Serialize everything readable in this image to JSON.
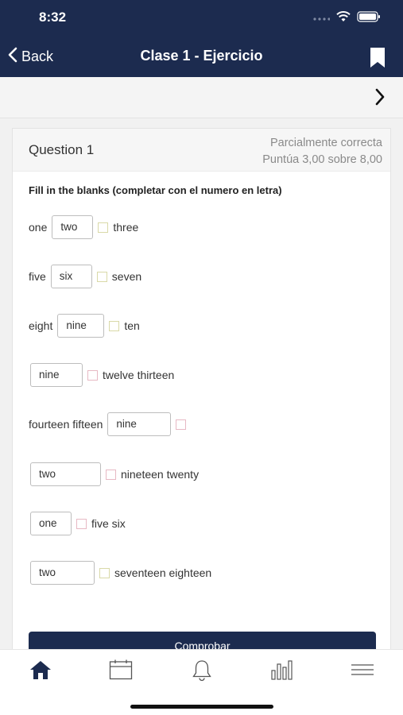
{
  "status": {
    "time": "8:32"
  },
  "nav": {
    "back_label": "Back",
    "title": "Clase 1 - Ejercicio"
  },
  "question": {
    "title": "Question 1",
    "state": "Parcialmente correcta",
    "score": "Puntúa 3,00 sobre 8,00",
    "instructions": "Fill in the blanks (completar con el numero en letra)",
    "rows": [
      {
        "before": "one",
        "answer": "two",
        "after": "three"
      },
      {
        "before": "five",
        "answer": "six",
        "after": "seven"
      },
      {
        "before": "eight",
        "answer": "nine",
        "after": "ten"
      },
      {
        "before": "",
        "answer": "nine",
        "after": "twelve thirteen"
      },
      {
        "before": "fourteen fifteen",
        "answer": "nine",
        "after": ""
      },
      {
        "before": "",
        "answer": "two",
        "after": "nineteen twenty"
      },
      {
        "before": "",
        "answer": "one",
        "after": "five six"
      },
      {
        "before": "",
        "answer": "two",
        "after": "seventeen eighteen"
      }
    ],
    "check_button": "Comprobar"
  },
  "tabs": [
    "home-icon",
    "calendar-icon",
    "bell-icon",
    "chart-icon",
    "menu-icon"
  ],
  "colors": {
    "header": "#1c2b4f",
    "accent": "#1c2b4f"
  }
}
